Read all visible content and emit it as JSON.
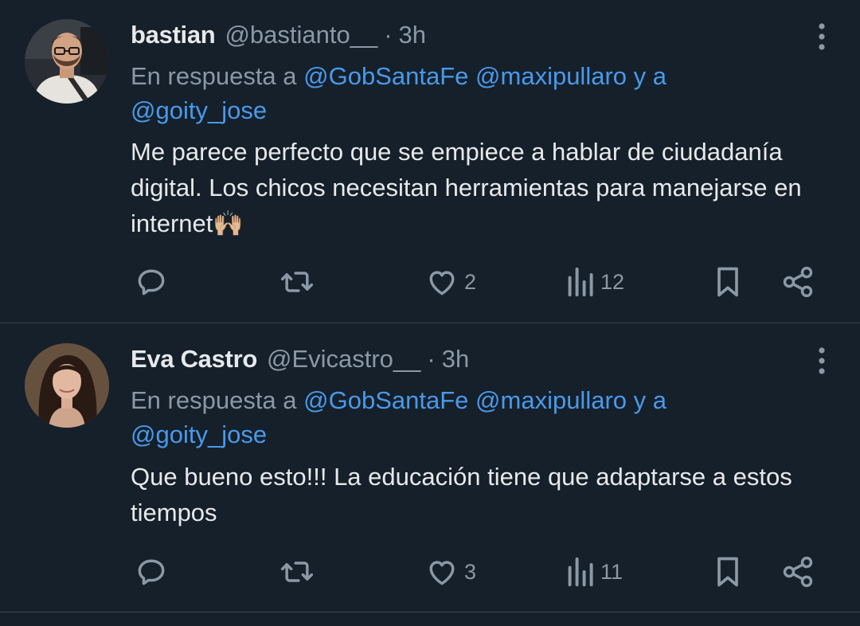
{
  "tweets": [
    {
      "name": "bastian",
      "handle": "@bastianto__",
      "separator": "·",
      "time": "3h",
      "reply_prefix": "En respuesta a ",
      "mention_1": "@GobSantaFe",
      "mention_2": "@maxipullaro",
      "mention_joiner": " y a",
      "mention_3": "@goity_jose",
      "text": "Me parece perfecto que se empiece a hablar de ciudadanía digital. Los chicos necesitan herramientas para manejarse en internet🙌🏼",
      "likes": "2",
      "views": "12",
      "icons": [
        "more-vertical-icon",
        "reply-icon",
        "retweet-icon",
        "like-icon",
        "views-icon",
        "bookmark-icon",
        "share-icon"
      ]
    },
    {
      "name": "Eva Castro",
      "handle": "@Evicastro__",
      "separator": "·",
      "time": "3h",
      "reply_prefix": "En respuesta a ",
      "mention_1": "@GobSantaFe",
      "mention_2": "@maxipullaro",
      "mention_joiner": " y a",
      "mention_3": "@goity_jose",
      "text": "Que bueno esto!!! La educación tiene que adaptarse a estos tiempos",
      "likes": "3",
      "views": "11",
      "icons": [
        "more-vertical-icon",
        "reply-icon",
        "retweet-icon",
        "like-icon",
        "views-icon",
        "bookmark-icon",
        "share-icon"
      ]
    }
  ],
  "colors": {
    "background": "#15202b",
    "text_primary": "#e7e9ea",
    "text_secondary": "#8b98a5",
    "link": "#4a99e9",
    "divider": "#38444d"
  }
}
